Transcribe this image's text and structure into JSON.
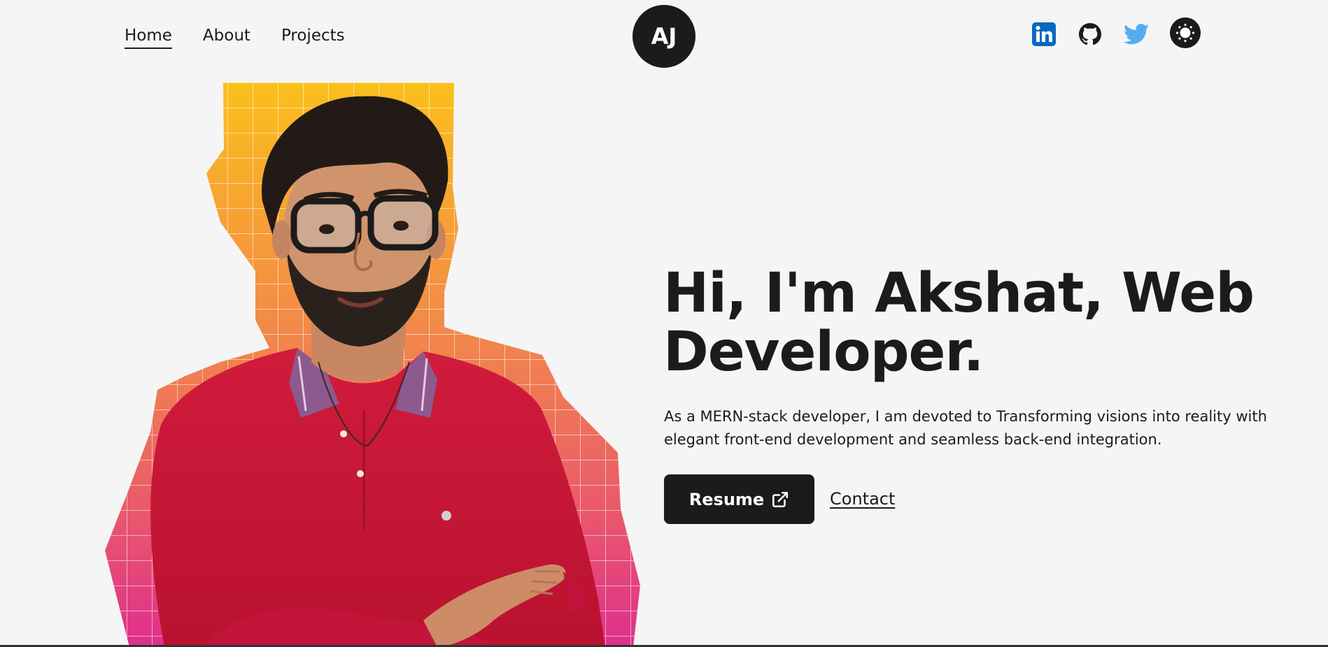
{
  "nav": {
    "items": [
      {
        "label": "Home",
        "active": true
      },
      {
        "label": "About",
        "active": false
      },
      {
        "label": "Projects",
        "active": false
      }
    ]
  },
  "logo": {
    "initials": "AJ"
  },
  "socials": [
    {
      "icon": "linkedin-icon",
      "color": "#0a66c2"
    },
    {
      "icon": "github-icon",
      "color": "#1b1b1b"
    },
    {
      "icon": "twitter-icon",
      "color": "#55acee"
    }
  ],
  "theme_toggle": {
    "icon": "sun-icon"
  },
  "hero": {
    "title": "Hi, I'm Akshat, Web Developer.",
    "description": "As a MERN-stack developer, I am devoted to Transforming visions into reality with elegant front-end development and seamless back-end integration.",
    "resume_label": "Resume",
    "contact_label": "Contact"
  },
  "colors": {
    "background": "#f5f5f5",
    "dark": "#1b1b1b",
    "gradient_top": "#fbbf24",
    "gradient_mid": "#f2754a",
    "gradient_bottom": "#e0308a",
    "shirt": "#c8163a"
  }
}
